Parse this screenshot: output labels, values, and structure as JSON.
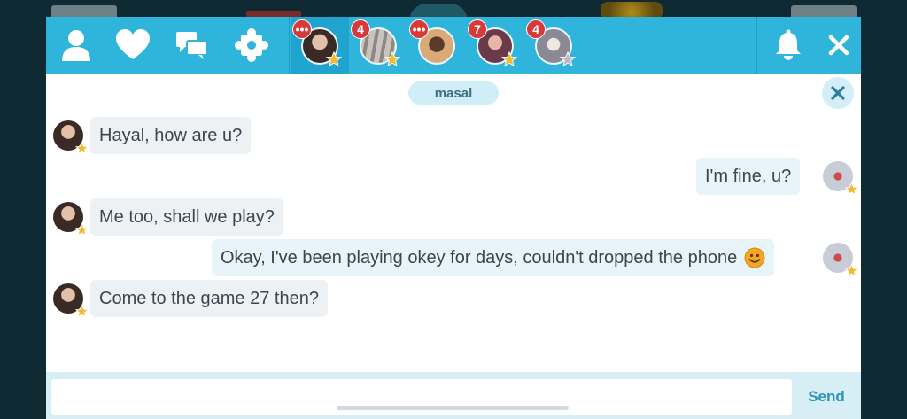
{
  "topbar": {
    "icons": [
      "profile-icon",
      "heart-icon",
      "chat-bubbles-icon",
      "puzzle-icon",
      "bell-icon",
      "close-icon"
    ],
    "tabs": [
      {
        "badge": "•••",
        "active": true,
        "star": "gold"
      },
      {
        "badge": "4",
        "active": false,
        "star": "gold"
      },
      {
        "badge": "•••",
        "active": false,
        "star": "none"
      },
      {
        "badge": "7",
        "active": false,
        "star": "gold"
      },
      {
        "badge": "4",
        "active": false,
        "star": "silver"
      }
    ]
  },
  "chat": {
    "partner_name": "masal",
    "messages": [
      {
        "direction": "incoming",
        "text": "Hayal, how are u?"
      },
      {
        "direction": "outgoing",
        "text": "I'm fine, u?"
      },
      {
        "direction": "incoming",
        "text": "Me too, shall we play?"
      },
      {
        "direction": "outgoing",
        "text": "Okay, I've been playing okey for days, couldn't dropped the phone",
        "emoji": "smiling-face-emoji"
      },
      {
        "direction": "incoming",
        "text": "Come to the game 27 then?"
      }
    ]
  },
  "composer": {
    "value": "",
    "placeholder": "",
    "send_label": "Send"
  },
  "colors": {
    "topbar": "#2fb4dc",
    "active_tab": "#1fa3cf",
    "badge": "#d83a3a",
    "name_pill": "#cfeef8",
    "send": "#2a93b8",
    "star_gold": "#f2b933",
    "star_silver": "#b8b8c0"
  }
}
